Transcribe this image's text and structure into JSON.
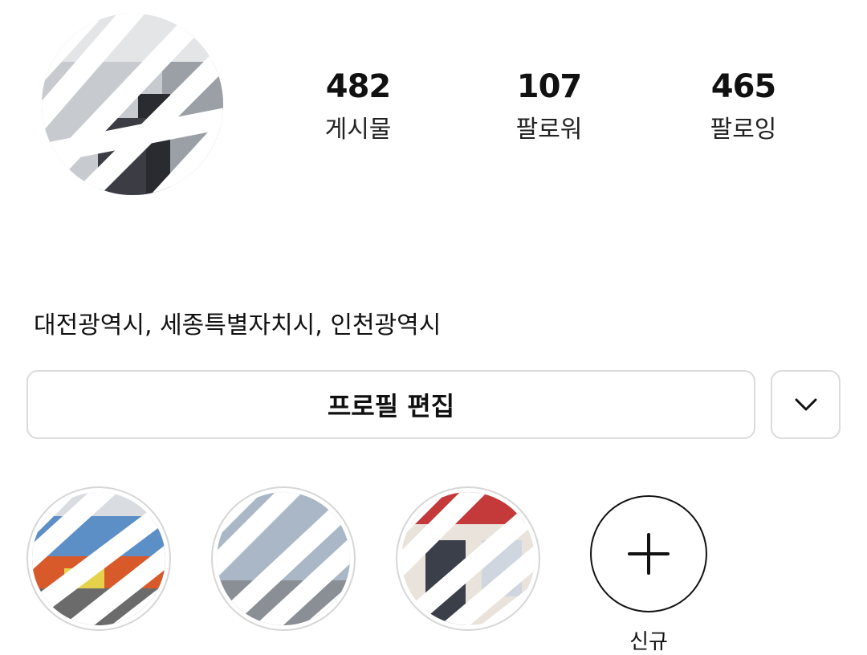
{
  "profile": {
    "avatar_icon": "profile-photo"
  },
  "stats": [
    {
      "value": "482",
      "label": "게시물"
    },
    {
      "value": "107",
      "label": "팔로워"
    },
    {
      "value": "465",
      "label": "팔로잉"
    }
  ],
  "bio": "대전광역시, 세종특별자치시, 인천광역시",
  "actions": {
    "edit_profile_label": "프로필 편집",
    "dropdown_icon": "chevron-down-icon"
  },
  "highlights": {
    "items": [
      {
        "thumb": "highlight-photo-1"
      },
      {
        "thumb": "highlight-photo-2"
      },
      {
        "thumb": "highlight-photo-3"
      }
    ],
    "new_icon": "plus-icon",
    "new_label": "신규"
  },
  "colors": {
    "border": "#dbdbdb",
    "text": "#111111",
    "background": "#ffffff"
  }
}
